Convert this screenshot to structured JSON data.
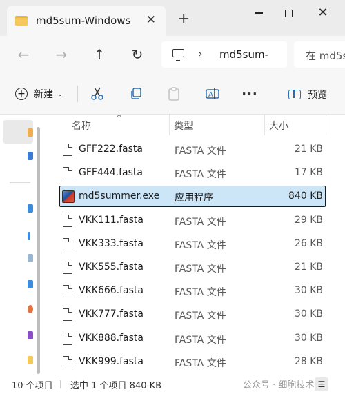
{
  "window": {
    "tab_title": "md5sum-Windows",
    "tab_close": "✕",
    "new_tab": "+",
    "minimize_icon": "minimize-icon",
    "maximize_icon": "maximize-icon",
    "close_glyph": "✕"
  },
  "nav": {
    "back": "←",
    "forward": "→",
    "up": "↑",
    "refresh": "↻",
    "address_chevron": "›",
    "address_text": "md5sum-",
    "search_text": "在 md5s"
  },
  "commands": {
    "new_label": "新建",
    "new_caret": "⌄",
    "more": "···",
    "preview_label": "预览"
  },
  "columns": {
    "name": "名称",
    "type": "类型",
    "size": "大小",
    "sort_indicator": "^"
  },
  "files": [
    {
      "name": "GFF222.fasta",
      "type": "FASTA 文件",
      "size": "21 KB",
      "icon": "file-icon",
      "selected": false
    },
    {
      "name": "GFF444.fasta",
      "type": "FASTA 文件",
      "size": "17 KB",
      "icon": "file-icon",
      "selected": false
    },
    {
      "name": "md5summer.exe",
      "type": "应用程序",
      "size": "840 KB",
      "icon": "app-icon",
      "selected": true
    },
    {
      "name": "VKK111.fasta",
      "type": "FASTA 文件",
      "size": "29 KB",
      "icon": "file-icon",
      "selected": false
    },
    {
      "name": "VKK333.fasta",
      "type": "FASTA 文件",
      "size": "26 KB",
      "icon": "file-icon",
      "selected": false
    },
    {
      "name": "VKK555.fasta",
      "type": "FASTA 文件",
      "size": "21 KB",
      "icon": "file-icon",
      "selected": false
    },
    {
      "name": "VKK666.fasta",
      "type": "FASTA 文件",
      "size": "30 KB",
      "icon": "file-icon",
      "selected": false
    },
    {
      "name": "VKK777.fasta",
      "type": "FASTA 文件",
      "size": "30 KB",
      "icon": "file-icon",
      "selected": false
    },
    {
      "name": "VKK888.fasta",
      "type": "FASTA 文件",
      "size": "30 KB",
      "icon": "file-icon",
      "selected": false
    },
    {
      "name": "VKK999.fasta",
      "type": "FASTA 文件",
      "size": "28 KB",
      "icon": "file-icon",
      "selected": false
    }
  ],
  "status": {
    "item_count": "10 个项目",
    "selection": "选中 1 个项目  840 KB",
    "watermark": "公众号 · 细胞技术",
    "view_glyph": "☰"
  },
  "colors": {
    "selection_bg": "#cde6f7",
    "accent": "#2b6cb0",
    "folder": "#f5c85b"
  }
}
